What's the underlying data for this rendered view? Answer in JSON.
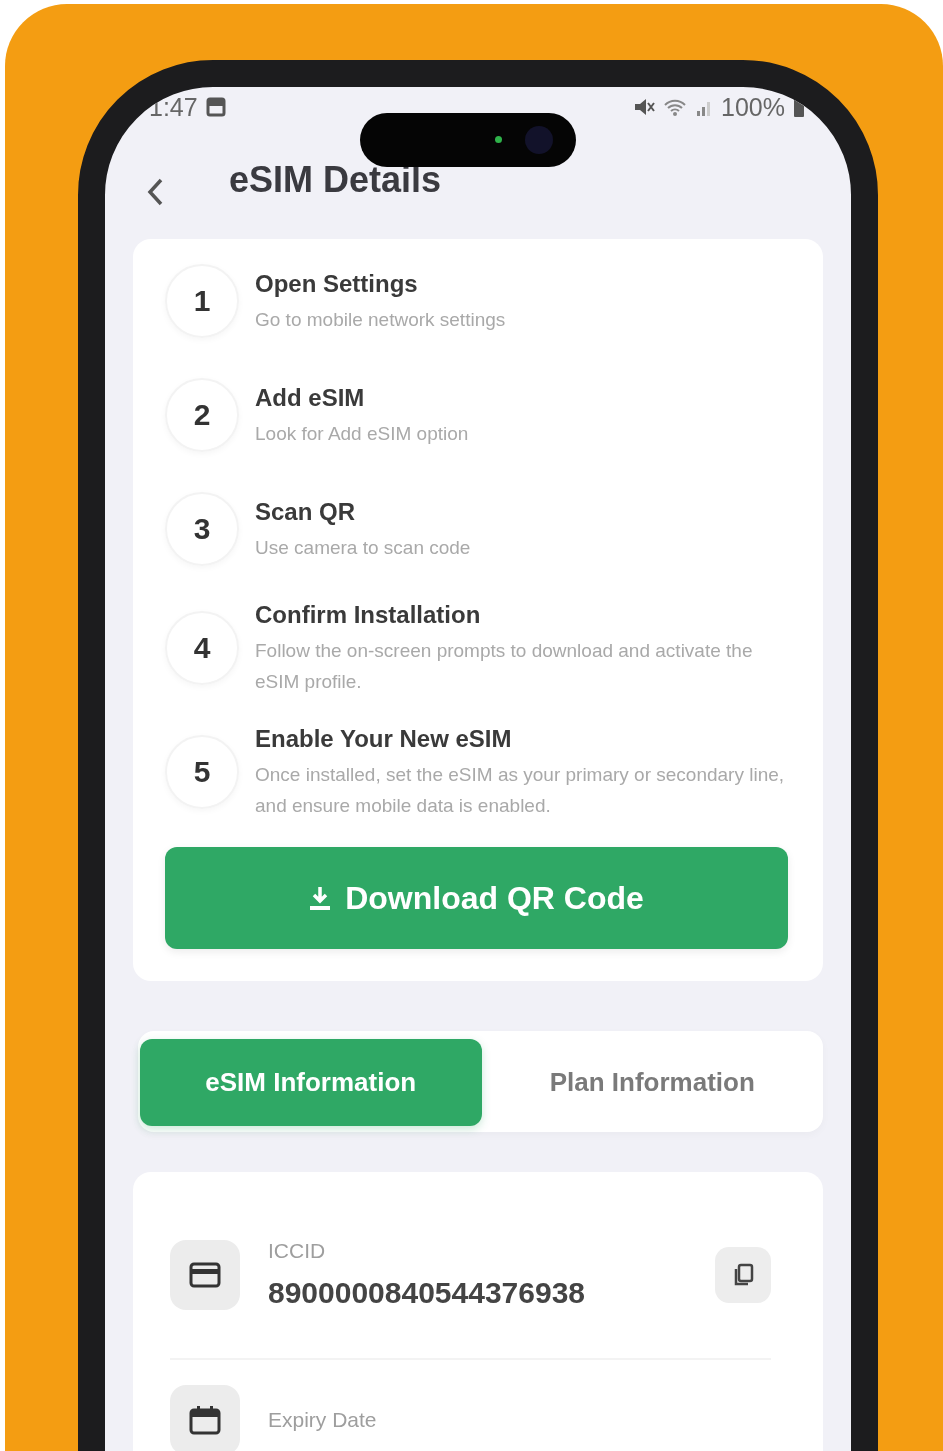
{
  "status_bar": {
    "time": "1:47",
    "battery": "100%"
  },
  "header": {
    "title": "eSIM Details"
  },
  "steps": [
    {
      "number": "1",
      "title": "Open Settings",
      "description": "Go to mobile network settings"
    },
    {
      "number": "2",
      "title": "Add eSIM",
      "description": "Look for Add eSIM option"
    },
    {
      "number": "3",
      "title": "Scan QR",
      "description": "Use camera to scan code"
    },
    {
      "number": "4",
      "title": "Confirm Installation",
      "description": "Follow the on-screen prompts to download and activate the eSIM profile."
    },
    {
      "number": "5",
      "title": "Enable Your New eSIM",
      "description": "Once installed, set the eSIM as your primary or secondary line, and ensure mobile data is enabled."
    }
  ],
  "download_button": {
    "label": "Download QR Code"
  },
  "tabs": [
    {
      "label": "eSIM Information",
      "selected": true
    },
    {
      "label": "Plan Information",
      "selected": false
    }
  ],
  "info_rows": [
    {
      "kind": "card",
      "label": "ICCID",
      "value": "8900000840544376938",
      "copyable": true
    },
    {
      "kind": "calendar",
      "label": "Expiry Date",
      "copyable": false
    }
  ]
}
